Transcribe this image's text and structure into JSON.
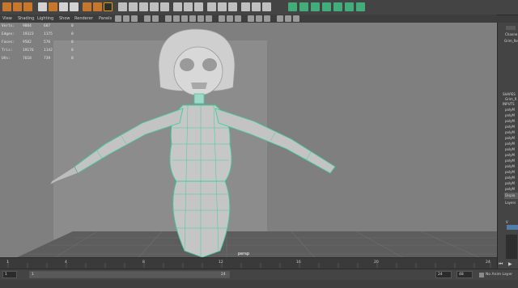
{
  "panel_menu": [
    "View",
    "Shading",
    "Lighting",
    "Show",
    "Renderer",
    "Panels"
  ],
  "hud": [
    {
      "label": "Verts:",
      "v1": "9884",
      "v2": "687",
      "v3": "0"
    },
    {
      "label": "Edges:",
      "v1": "19323",
      "v2": "1175",
      "v3": "0"
    },
    {
      "label": "Faces:",
      "v1": "9502",
      "v2": "576",
      "v3": "0"
    },
    {
      "label": "Tris:",
      "v1": "19176",
      "v2": "1142",
      "v3": "0"
    },
    {
      "label": "UVs:",
      "v1": "7618",
      "v2": "739",
      "v3": "0"
    }
  ],
  "camera_label": "persp",
  "channel_box": {
    "header": "Channe",
    "object": "Grim_Re",
    "shapes": "SHAPES",
    "shape_name": "Grim_R",
    "inputs": "INPUTS",
    "inputs_list": [
      "polyM",
      "polyM",
      "polyM",
      "polyM",
      "polyM",
      "polyM",
      "polyM",
      "polyM",
      "polyM",
      "polyM",
      "polyM",
      "polyM",
      "polyM",
      "polyM",
      "polyM"
    ],
    "display_tab": "Displa",
    "layers_menu": "Layers",
    "layer_v": "V"
  },
  "time_ticks": [
    "1",
    "4",
    "8",
    "12",
    "16",
    "20",
    "24"
  ],
  "range": {
    "start": "1",
    "start2": "1",
    "current": "24",
    "end": "24",
    "max": "48",
    "no_anim_layer": "No Anim Layer"
  }
}
